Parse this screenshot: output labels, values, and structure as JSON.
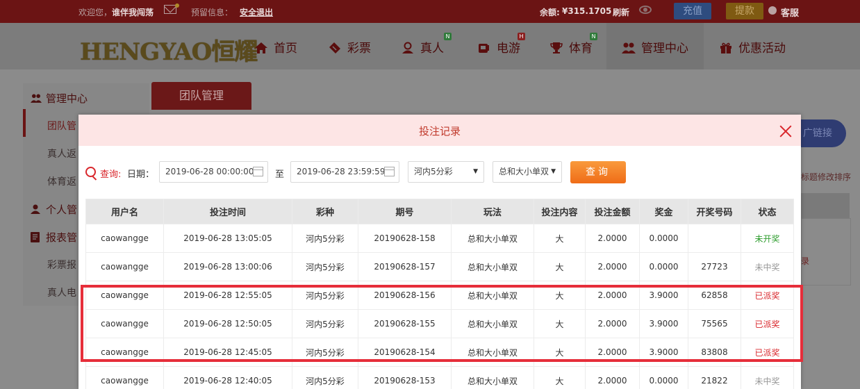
{
  "topbar": {
    "welcome": "欢迎您，",
    "username": "谁伴我闯荡",
    "alert_label": "预留信息：",
    "logout": "安全退出",
    "balance_label": "余额:",
    "balance_value": "¥315.1705",
    "refresh": "刷新",
    "recharge": "充值",
    "withdraw": "提款",
    "customer_service": "客服"
  },
  "nav": {
    "logo": "HENGYAO恒耀",
    "items": [
      {
        "label": "首页",
        "icon": "home-icon"
      },
      {
        "label": "彩票",
        "icon": "ticket-icon"
      },
      {
        "label": "真人",
        "icon": "dealer-icon",
        "badge": "N"
      },
      {
        "label": "电游",
        "icon": "slot-icon",
        "badge": "H"
      },
      {
        "label": "体育",
        "icon": "trophy-icon",
        "badge": "N"
      },
      {
        "label": "管理中心",
        "icon": "users-icon"
      },
      {
        "label": "优惠活动",
        "icon": "gift-icon"
      }
    ]
  },
  "sidebar": {
    "items": [
      {
        "label": "管理中心",
        "icon": "users-icon"
      },
      {
        "label": "团队管"
      },
      {
        "label": "真人返"
      },
      {
        "label": "体育返"
      },
      {
        "label": "个人管",
        "icon": "user-icon"
      },
      {
        "label": "报表管",
        "icon": "report-icon"
      },
      {
        "label": "彩票报"
      },
      {
        "label": "真人电"
      }
    ]
  },
  "page": {
    "tab": "团队管理",
    "promo_link": "广链接",
    "sort_hint": "标题修改排序",
    "side_link": "录"
  },
  "modal": {
    "title": "投注记录",
    "query_label": "查询:",
    "date_label": "日期：",
    "start_date": "2019-06-28 00:00:00",
    "to_label": "至",
    "end_date": "2019-06-28 23:59:59",
    "lottery_select": "河内5分彩",
    "play_select": "总和大小单双",
    "query_button": "查询",
    "columns": [
      "用户名",
      "投注时间",
      "彩种",
      "期号",
      "玩法",
      "投注内容",
      "投注金额",
      "奖金",
      "开奖号码",
      "状态"
    ],
    "rows": [
      {
        "user": "caowangge",
        "time": "2019-06-28 13:05:05",
        "lottery": "河内5分彩",
        "issue": "20190628-158",
        "play": "总和大小单双",
        "content": "大",
        "amount": "2.0000",
        "bonus": "0.0000",
        "numbers": "",
        "status": "未开奖",
        "status_type": "open"
      },
      {
        "user": "caowangge",
        "time": "2019-06-28 13:00:06",
        "lottery": "河内5分彩",
        "issue": "20190628-157",
        "play": "总和大小单双",
        "content": "大",
        "amount": "2.0000",
        "bonus": "0.0000",
        "numbers": "27723",
        "status": "未中奖",
        "status_type": "none"
      },
      {
        "user": "caowangge",
        "time": "2019-06-28 12:55:05",
        "lottery": "河内5分彩",
        "issue": "20190628-156",
        "play": "总和大小单双",
        "content": "大",
        "amount": "2.0000",
        "bonus": "3.9000",
        "numbers": "62858",
        "status": "已派奖",
        "status_type": "paid"
      },
      {
        "user": "caowangge",
        "time": "2019-06-28 12:50:05",
        "lottery": "河内5分彩",
        "issue": "20190628-155",
        "play": "总和大小单双",
        "content": "大",
        "amount": "2.0000",
        "bonus": "3.9000",
        "numbers": "75565",
        "status": "已派奖",
        "status_type": "paid"
      },
      {
        "user": "caowangge",
        "time": "2019-06-28 12:45:05",
        "lottery": "河内5分彩",
        "issue": "20190628-154",
        "play": "总和大小单双",
        "content": "大",
        "amount": "2.0000",
        "bonus": "3.9000",
        "numbers": "83808",
        "status": "已派奖",
        "status_type": "paid"
      },
      {
        "user": "caowangge",
        "time": "2019-06-28 12:40:05",
        "lottery": "河内5分彩",
        "issue": "20190628-153",
        "play": "总和大小单双",
        "content": "大",
        "amount": "2.0000",
        "bonus": "0.0000",
        "numbers": "21822",
        "status": "未中奖",
        "status_type": "none"
      }
    ]
  },
  "colors": {
    "brand_red": "#d9262b",
    "highlight_box": "#e62e3a",
    "query_orange": "#f47a22",
    "status_open": "#2e9d2e",
    "status_none": "#999999",
    "status_paid": "#d9262b"
  }
}
